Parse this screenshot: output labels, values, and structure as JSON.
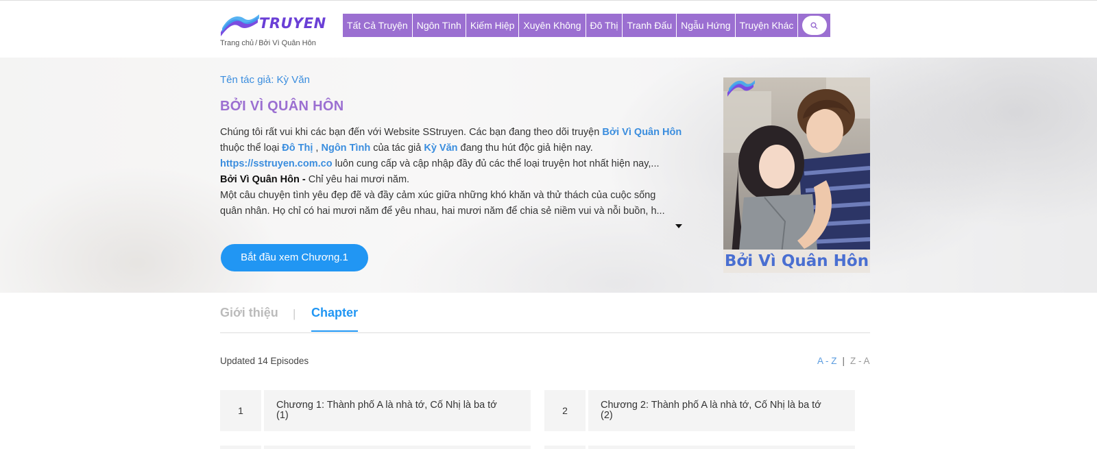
{
  "header": {
    "logo_text": "TRUYEN",
    "nav": [
      {
        "label": "Tất Cả Truyện"
      },
      {
        "label": "Ngôn Tình"
      },
      {
        "label": "Kiếm Hiệp"
      },
      {
        "label": "Xuyên Không"
      },
      {
        "label": "Đô Thị"
      },
      {
        "label": "Tranh Đấu"
      },
      {
        "label": "Ngẫu Hứng"
      },
      {
        "label": "Truyện Khác"
      }
    ],
    "search_icon": "search-icon",
    "breadcrumb": {
      "home": "Trang chủ",
      "current": "Bởi Vì Quân Hôn"
    }
  },
  "story": {
    "author": "Tên tác giả: Kỳ Văn",
    "title": "BỞI VÌ QUÂN HÔN",
    "desc_intro": "Chúng tôi rất vui khi các bạn đến với Website SStruyen. Các bạn đang theo dõi truyện ",
    "desc_story_link": "Bởi Vì Quân Hôn",
    "desc_genre_prefix": " thuộc thể loại ",
    "desc_genre_1": "Đô Thị",
    "desc_comma": " , ",
    "desc_genre_2": "Ngôn Tình",
    "desc_author_prefix": " của tác giả ",
    "desc_author_link": "Kỳ Văn",
    "desc_author_suffix": " đang thu hút độc giả hiện nay.",
    "desc_site_link": "https://sstruyen.com.co",
    "desc_site_suffix": " luôn cung cấp và cập nhập đầy đủ các thể loại truyện hot nhất hiện nay,...",
    "desc_tag_bold": "Bởi Vì Quân Hôn -",
    "desc_tag_rest": " Chỉ yêu hai mươi năm.",
    "desc_line_5": "Một câu chuyện tình yêu đẹp đẽ và đầy cảm xúc giữa những khó khăn và thử thách của cuộc sống",
    "desc_line_6": "quân nhân. Họ chỉ có hai mươi năm để yêu nhau, hai mươi năm để chia sẻ niềm vui và nỗi buồn, h...",
    "start_button": "Bắt đầu xem Chương.1",
    "cover_caption": "Bởi Vì Quân Hôn"
  },
  "tabs": {
    "intro": "Giới thiệu",
    "separator": "|",
    "chapter": "Chapter"
  },
  "chapters": {
    "updated": "Updated 14 Episodes",
    "sort_az": "A - Z",
    "sort_sep": "|",
    "sort_za": "Z - A",
    "items": [
      {
        "num": "1",
        "line1": "Chương 1: Thành phố A là nhà tớ, Cố Nhị là ba tớ",
        "line2": "(1)"
      },
      {
        "num": "2",
        "line1": "Chương 2: Thành phố A là nhà tớ, Cố Nhị là ba tớ",
        "line2": "(2)"
      }
    ]
  },
  "colors": {
    "nav_bg": "#9b6fd1",
    "title": "#9b6fd1",
    "link": "#3a8dde",
    "button": "#2196f3"
  }
}
